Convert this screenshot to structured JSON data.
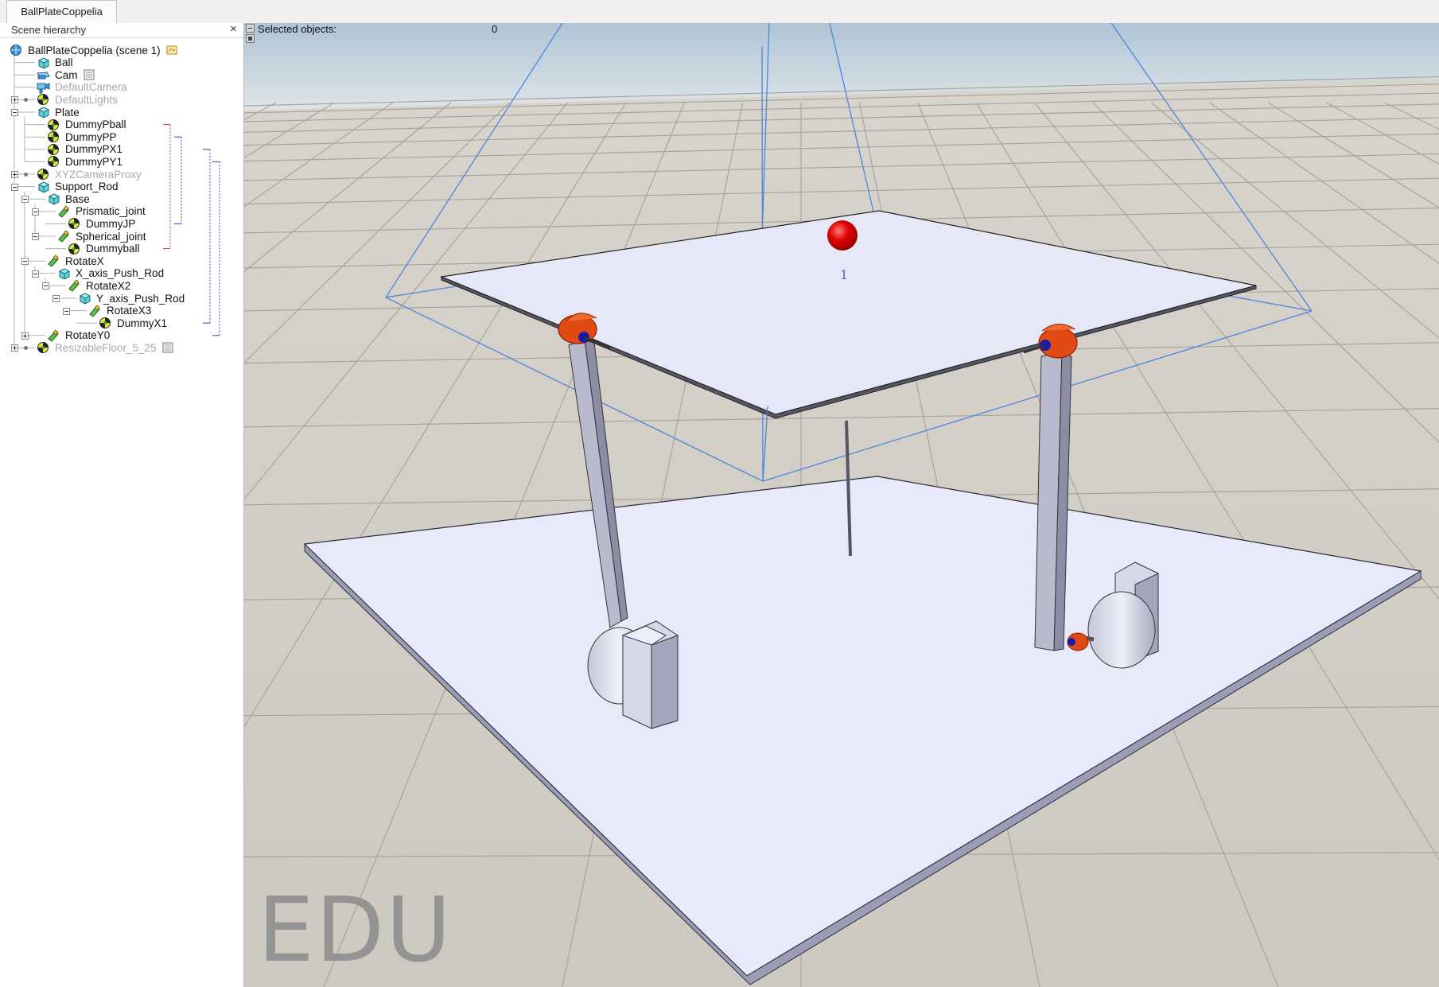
{
  "tabs": [
    {
      "label": "BallPlateCoppelia"
    }
  ],
  "hierarchy": {
    "title": "Scene hierarchy",
    "close_glyph": "×",
    "items": [
      {
        "label": "BallPlateCoppelia (scene 1)",
        "icon": "scene-icon",
        "dim": false
      },
      {
        "label": "Ball",
        "icon": "shape-icon",
        "dim": false
      },
      {
        "label": "Cam",
        "icon": "vision-sensor-icon",
        "dim": false
      },
      {
        "label": "DefaultCamera",
        "icon": "camera-icon",
        "dim": true
      },
      {
        "label": "DefaultLights",
        "icon": "dummy-icon",
        "dim": true
      },
      {
        "label": "Plate",
        "icon": "shape-icon",
        "dim": false
      },
      {
        "label": "DummyPball",
        "icon": "dummy-icon",
        "dim": false
      },
      {
        "label": "DummyPP",
        "icon": "dummy-icon",
        "dim": false
      },
      {
        "label": "DummyPX1",
        "icon": "dummy-icon",
        "dim": false
      },
      {
        "label": "DummyPY1",
        "icon": "dummy-icon",
        "dim": false
      },
      {
        "label": "XYZCameraProxy",
        "icon": "dummy-icon",
        "dim": true
      },
      {
        "label": "Support_Rod",
        "icon": "shape-icon",
        "dim": false
      },
      {
        "label": "Base",
        "icon": "shape-icon",
        "dim": false
      },
      {
        "label": "Prismatic_joint",
        "icon": "joint-icon",
        "dim": false
      },
      {
        "label": "DummyJP",
        "icon": "dummy-icon",
        "dim": false
      },
      {
        "label": "Spherical_joint",
        "icon": "joint-icon",
        "dim": false
      },
      {
        "label": "Dummyball",
        "icon": "dummy-icon",
        "dim": false
      },
      {
        "label": "RotateX",
        "icon": "joint-icon",
        "dim": false
      },
      {
        "label": "X_axis_Push_Rod",
        "icon": "shape-icon",
        "dim": false
      },
      {
        "label": "RotateX2",
        "icon": "joint-icon",
        "dim": false
      },
      {
        "label": "Y_axis_Push_Rod",
        "icon": "shape-icon",
        "dim": false
      },
      {
        "label": "RotateX3",
        "icon": "joint-icon",
        "dim": false
      },
      {
        "label": "DummyX1",
        "icon": "dummy-icon",
        "dim": false
      },
      {
        "label": "RotateY0",
        "icon": "joint-icon",
        "dim": false
      },
      {
        "label": "ResizableFloor_5_25",
        "icon": "dummy-icon",
        "dim": true
      }
    ]
  },
  "viewport": {
    "selected_label": "Selected objects:",
    "selected_count": "0",
    "ball_label": "1",
    "watermark": "EDU"
  },
  "colors": {
    "accent_link_red": "#e03030",
    "accent_link_blue": "#3040d0",
    "plate": "#e6e7f7",
    "ball": "#d40000",
    "motor_orange": "#e24a14",
    "frustum": "#3a7fe0"
  }
}
